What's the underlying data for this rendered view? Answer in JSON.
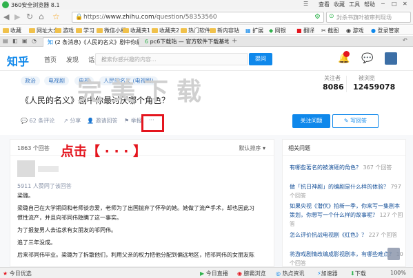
{
  "browser": {
    "title": "360安全浏览器 8.1",
    "url_scheme": "https://",
    "url_host": "www.zhihu.com",
    "url_path": "/question/58353560",
    "search_placeholder": "封杀书旗叶被审判现场",
    "bookmarks": [
      "收藏",
      "网址大全",
      "游戏",
      "学习",
      "微信小程",
      "收藏夹1",
      "收藏夹2",
      "热门软件",
      "新内容站",
      "扩展",
      "网银",
      "翻译",
      "截图",
      "游戏",
      "登录管家"
    ],
    "tabs": [
      "(2 条消息)《人民的名义》剧中你最讨厌哪个角色？",
      "pc6下载站 — 官方软件下载基地_最安全..."
    ],
    "status": {
      "left": "今日优选",
      "center_items": [
        "今日直播",
        "膀霸浏览",
        "热点资讯"
      ],
      "right_items": [
        "加速器",
        "下载",
        "100%"
      ]
    }
  },
  "zhihu": {
    "logo": "知乎",
    "nav": [
      "首页",
      "发现",
      "话题"
    ],
    "search_placeholder": "搜索你感兴趣的内容...",
    "ask_button": "提问",
    "question": {
      "tags": [
        "政治",
        "电视剧",
        "电视",
        "人民的名义 (电视剧)"
      ],
      "title": "《人民的名义》剧中你最讨厌哪个角色？",
      "followers_label": "关注者",
      "followers": "8086",
      "views_label": "被浏览",
      "views": "12459078",
      "actions": [
        "62 条评论",
        "分享",
        "邀请回答",
        "举报",
        "···"
      ],
      "follow_button": "关注问题",
      "write_button": "写回答"
    },
    "answers": {
      "count": "1863 个回答",
      "sort": "默认排序",
      "voters": "5911 人赞同了该回答",
      "lines": [
        "梁璐。",
        "梁璐自己在大学期间和老师谈恋爱，老师为了出国抛弃了怀孕的她。她做了流产手术，却也因此习",
        "惯性流产，并且向祁同伟隐瞒了这一事实。",
        "为了报复男人去追求有女朋友的祁同伟。",
        "追了三年没成。",
        "后来祁同伟毕业。梁璐为了拆散他们，利用父亲的权力把他分配到偏远地区，把祁同伟的女朋友陈"
      ]
    },
    "related": {
      "title": "相关问题",
      "items": [
        {
          "q": "有哪些著名的被演砸的角色？",
          "n": "367 个回答"
        },
        {
          "q": "做「抗日神剧」的编剧是什么样的体验？",
          "n": "797 个回答"
        },
        {
          "q": "如果央视《潜伏》拍新一季，你来写一集剧本策划，你想写一个什么样的故事呢？",
          "n": "127 个回答"
        },
        {
          "q": "怎么评价抗战电视剧《红色》？",
          "n": "227 个回答"
        },
        {
          "q": "将游戏剧情改编成影视剧本，有哪些难点？",
          "n": "10 个回答"
        }
      ]
    }
  },
  "overlay": {
    "watermark": "完美下载",
    "instruction": "点击【 · · · 】"
  },
  "colors": {
    "zhihu_blue": "#0f88eb",
    "highlight_red": "#e4151e"
  }
}
